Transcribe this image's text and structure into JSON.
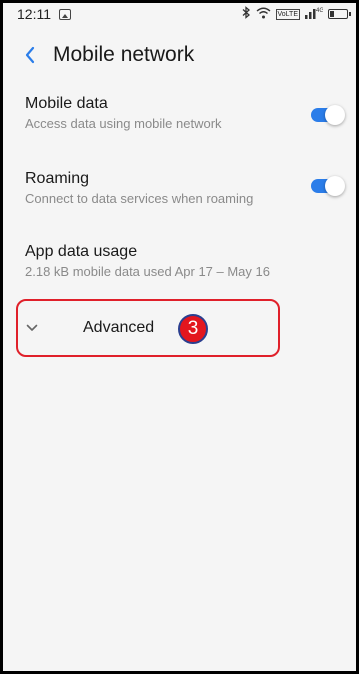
{
  "status_bar": {
    "time": "12:11",
    "icons": [
      "gallery-icon",
      "bluetooth-icon",
      "wifi-icon",
      "volte-icon",
      "signal-icon",
      "battery-icon"
    ],
    "volte_label": "VoLTE",
    "network_label": "4G"
  },
  "header": {
    "title": "Mobile network",
    "back_icon": "chevron-left-icon",
    "back_color": "#2b7de9"
  },
  "settings": {
    "mobile_data": {
      "title": "Mobile data",
      "subtitle": "Access data using mobile network",
      "enabled": true
    },
    "roaming": {
      "title": "Roaming",
      "subtitle": "Connect to data services when roaming",
      "enabled": true
    },
    "app_data_usage": {
      "title": "App data usage",
      "subtitle": "2.18 kB mobile data used Apr 17 – May 16"
    },
    "advanced": {
      "label": "Advanced",
      "icon": "chevron-down-icon"
    }
  },
  "annotation": {
    "step_number": "3",
    "highlight_color": "#e0202a",
    "badge_color": "#e3161e"
  },
  "colors": {
    "accent": "#2b7de9",
    "background": "#f5f5f5"
  }
}
